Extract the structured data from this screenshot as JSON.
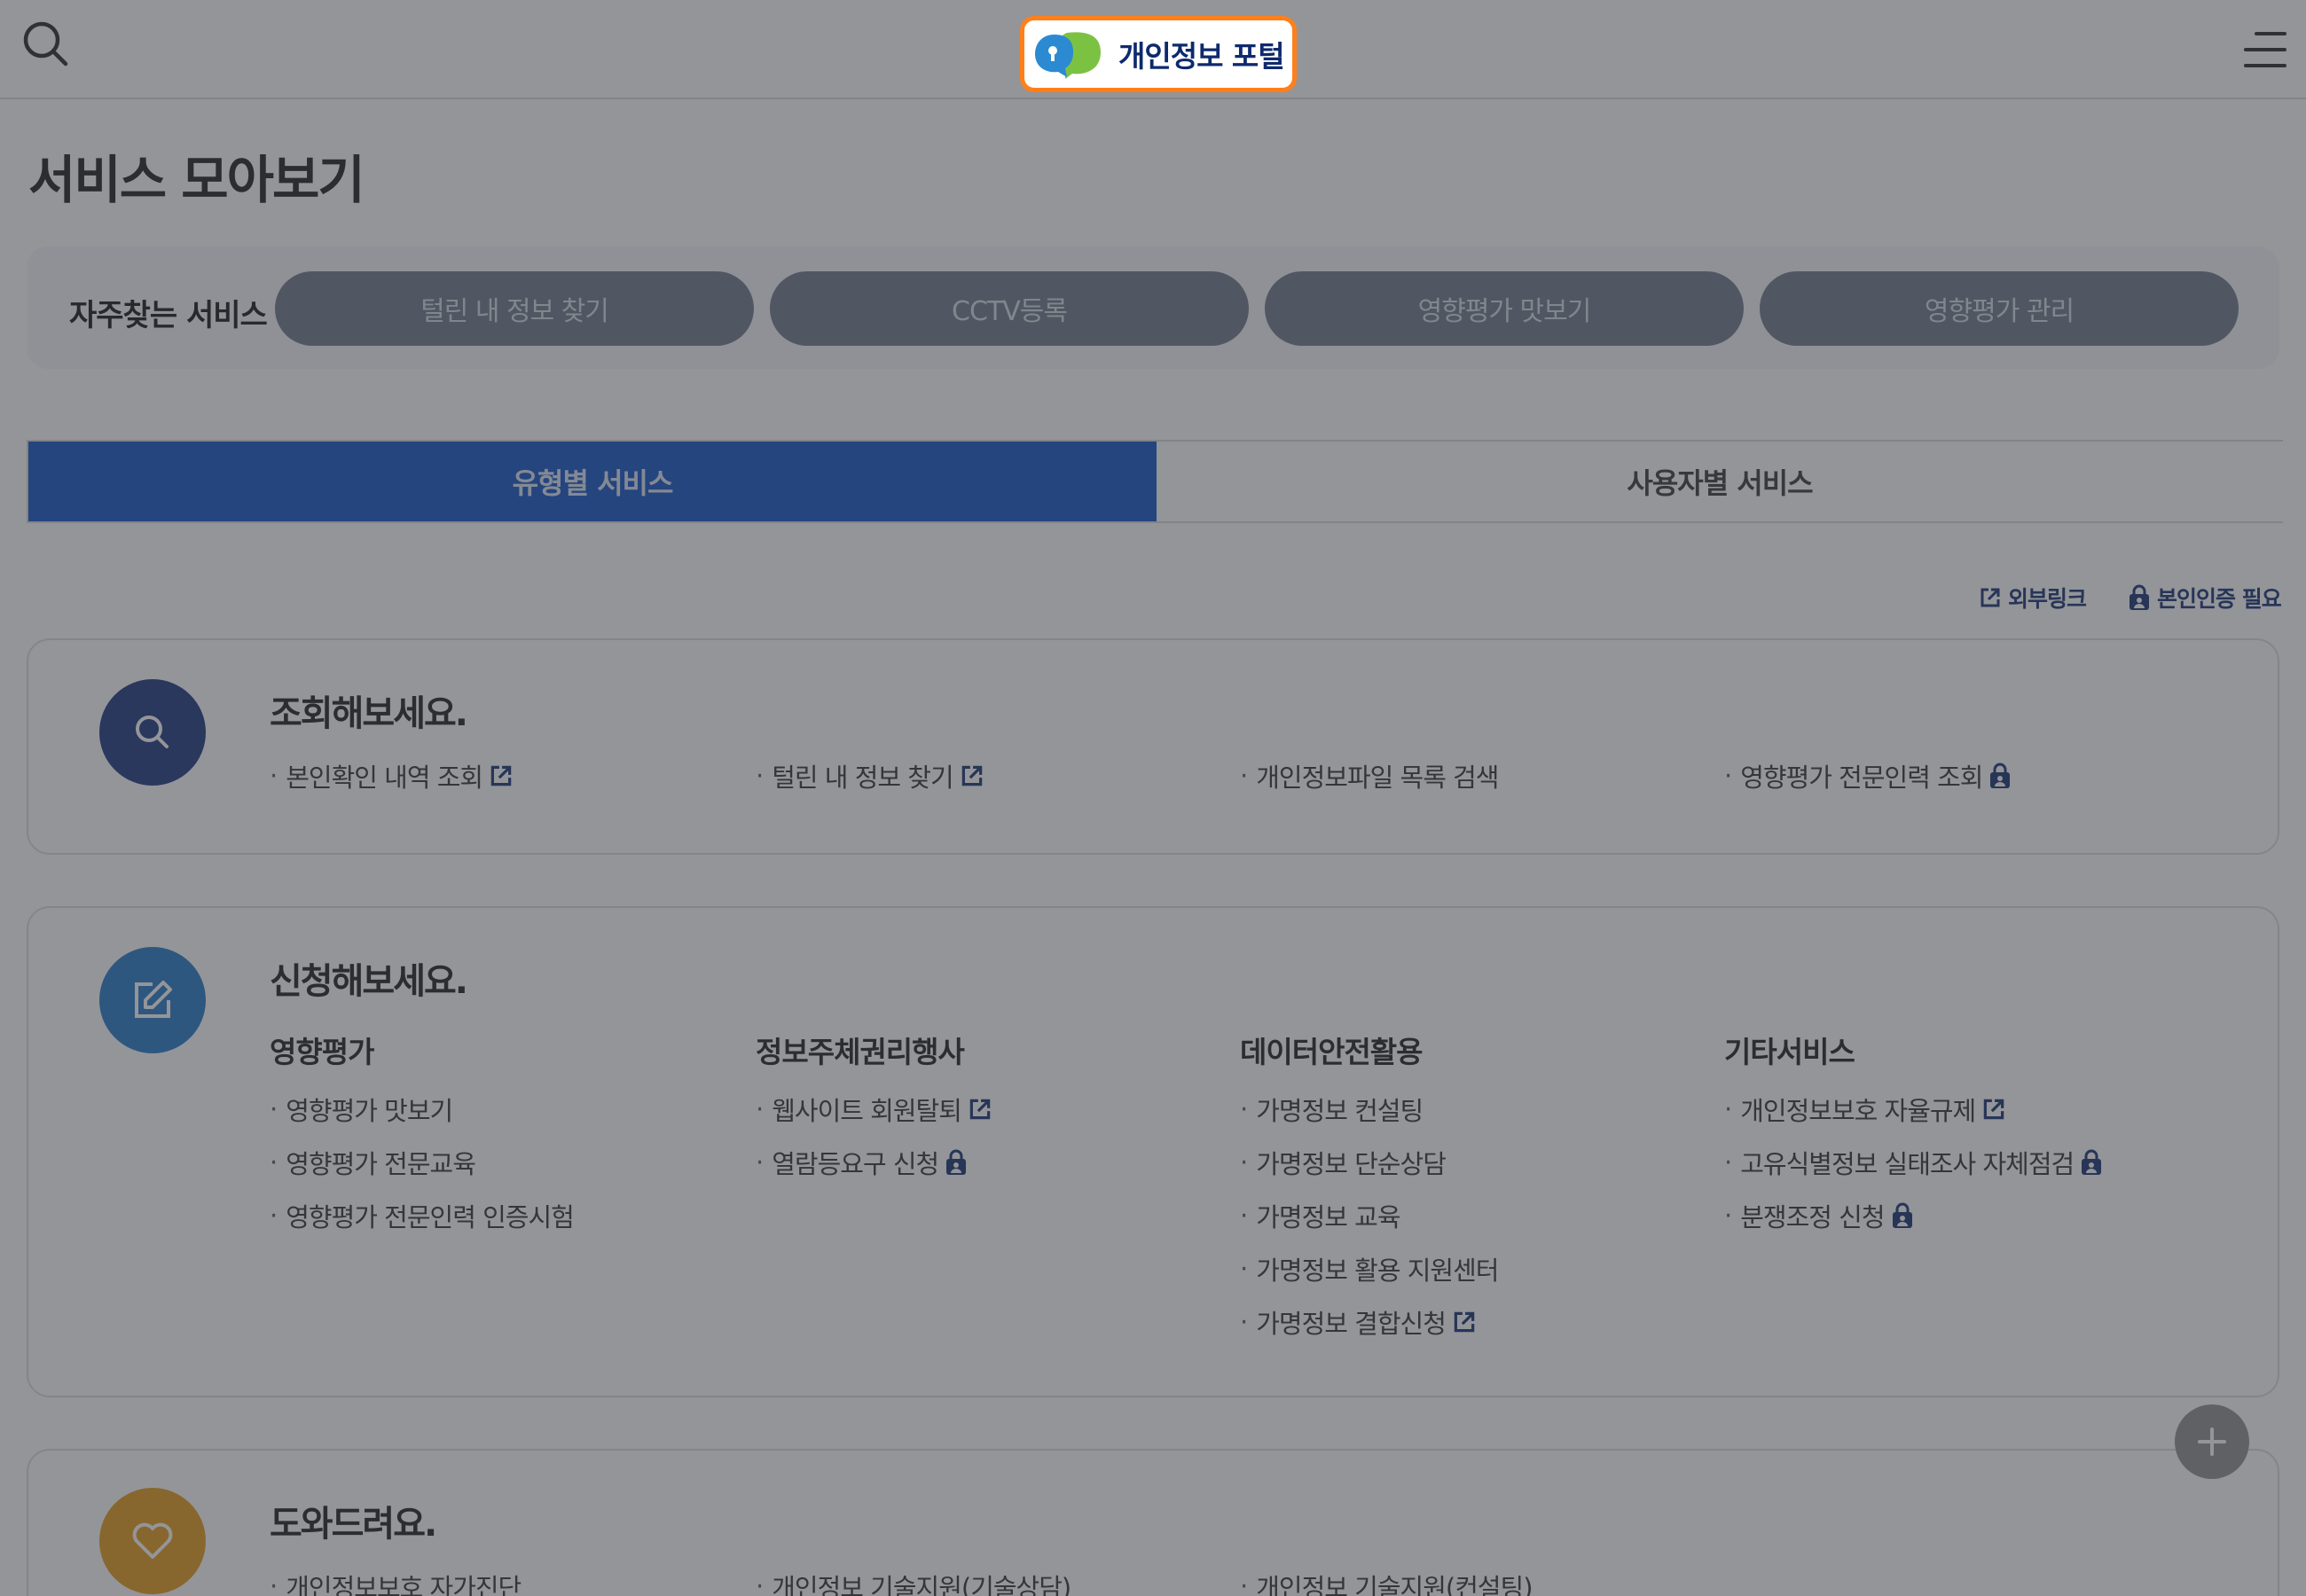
{
  "header": {
    "logo_text": "개인정보 포털",
    "search_icon": "search-icon",
    "menu_icon": "hamburger-menu-icon"
  },
  "page_title": "서비스 모아보기",
  "favorites": {
    "label": "자주찾는 서비스",
    "items": [
      "털린 내 정보 찾기",
      "CCTV등록",
      "영향평가 맛보기",
      "영향평가 관리"
    ]
  },
  "tabs": [
    {
      "label": "유형별 서비스",
      "active": true
    },
    {
      "label": "사용자별 서비스",
      "active": false
    }
  ],
  "legend": {
    "external_link": "외부링크",
    "auth_required": "본인인증 필요"
  },
  "cards": {
    "inquire": {
      "title": "조회해보세요.",
      "icon": "search-icon",
      "color": "#14317d",
      "items": [
        {
          "label": "본인확인 내역 조회",
          "badge": "external"
        },
        {
          "label": "털린 내 정보 찾기",
          "badge": "external"
        },
        {
          "label": "개인정보파일 목록 검색",
          "badge": ""
        },
        {
          "label": "영향평가 전문인력 조회",
          "badge": "lock"
        }
      ]
    },
    "apply": {
      "title": "신청해보세요.",
      "icon": "edit-icon",
      "color": "#1e76c6",
      "columns": [
        {
          "title": "영향평가",
          "items": [
            {
              "label": "영향평가 맛보기",
              "badge": ""
            },
            {
              "label": "영향평가 전문교육",
              "badge": ""
            },
            {
              "label": "영향평가 전문인력 인증시험",
              "badge": ""
            }
          ]
        },
        {
          "title": "정보주체권리행사",
          "items": [
            {
              "label": "웹사이트 회원탈퇴",
              "badge": "external"
            },
            {
              "label": "열람등요구 신청",
              "badge": "lock"
            }
          ]
        },
        {
          "title": "데이터안전활용",
          "items": [
            {
              "label": "가명정보 컨설팅",
              "badge": ""
            },
            {
              "label": "가명정보 단순상담",
              "badge": ""
            },
            {
              "label": "가명정보 교육",
              "badge": ""
            },
            {
              "label": "가명정보 활용 지원센터",
              "badge": ""
            },
            {
              "label": "가명정보 결합신청",
              "badge": "external"
            }
          ]
        },
        {
          "title": "기타서비스",
          "items": [
            {
              "label": "개인정보보호 자율규제",
              "badge": "external"
            },
            {
              "label": "고유식별정보 실태조사 자체점검",
              "badge": "lock"
            },
            {
              "label": "분쟁조정 신청",
              "badge": "lock"
            }
          ]
        }
      ]
    },
    "help": {
      "title": "도와드려요.",
      "icon": "heart-icon",
      "color": "#e49a12",
      "items": [
        {
          "label": "개인정보보호 자가진단",
          "badge": ""
        },
        {
          "label": "개인정보 기술지원(기술상담)",
          "badge": ""
        },
        {
          "label": "개인정보 기술지원(컨설팅)",
          "badge": ""
        }
      ]
    }
  },
  "fab_icon": "plus-icon",
  "colors": {
    "accent_blue": "#0b4ec4",
    "navy": "#0e2a6e",
    "highlight_orange": "#ff7f1a",
    "overlay": "rgba(60,62,70,0.55)"
  }
}
